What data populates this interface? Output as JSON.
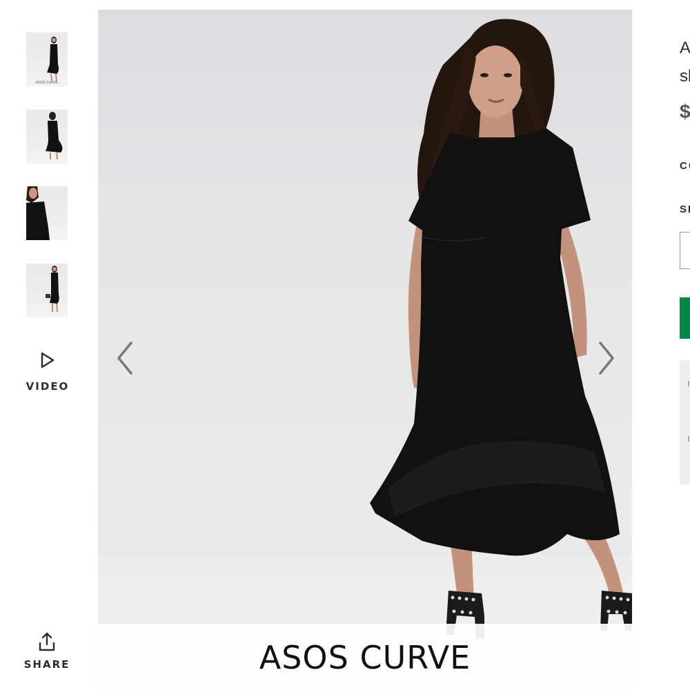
{
  "gallery": {
    "thumbnails": [
      {
        "view": "front",
        "caption": "ASOS CURVE"
      },
      {
        "view": "back",
        "caption": ""
      },
      {
        "view": "close-up",
        "caption": ""
      },
      {
        "view": "front-wide",
        "caption": ""
      }
    ],
    "video_label": "VIDEO",
    "share_label": "SHARE",
    "main_brand_label": "ASOS CURVE"
  },
  "product": {
    "title_line1": "A",
    "title_line2": "sl",
    "price": "$",
    "colour_label": "CO",
    "size_label": "SI"
  },
  "colors": {
    "add_to_bag": "#018849",
    "dress": "#111111",
    "background": "#e5e6e8"
  }
}
